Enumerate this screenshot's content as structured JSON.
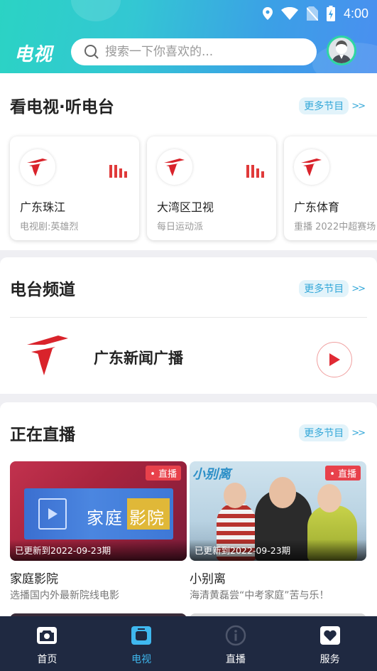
{
  "status_bar": {
    "time": "4:00"
  },
  "header": {
    "logo": "电视",
    "search_placeholder": "搜索一下你喜欢的..."
  },
  "section_tv": {
    "title": "看电视·听电台",
    "more": "更多节目",
    "arrow": ">>",
    "channels": [
      {
        "name": "广东珠江",
        "program": "电视剧:英雄烈"
      },
      {
        "name": "大湾区卫视",
        "program": "每日运动派"
      },
      {
        "name": "广东体育",
        "program": "重播 2022中超赛场"
      }
    ]
  },
  "section_radio": {
    "title": "电台频道",
    "more": "更多节目",
    "arrow": ">>",
    "station": {
      "name": "广东新闻广播"
    }
  },
  "section_live": {
    "title": "正在直播",
    "more": "更多节目",
    "arrow": ">>",
    "badge": "• 直播",
    "items": [
      {
        "title": "家庭影院",
        "desc": "选播国内外最新院线电影",
        "update": "已更新到2022-09-23期",
        "poster_text_1": "家庭",
        "poster_text_2": "影院"
      },
      {
        "title": "小别离",
        "desc": "海清黄磊尝“中考家庭”苦与乐！",
        "update": "已更新到2022-09-23期",
        "poster_logo": "小别离"
      }
    ]
  },
  "bottom_nav": {
    "items": [
      {
        "label": "首页",
        "icon": "home-camera-icon"
      },
      {
        "label": "电视",
        "icon": "tv-icon",
        "active": true
      },
      {
        "label": "直播",
        "icon": "info-icon"
      },
      {
        "label": "服务",
        "icon": "heart-icon"
      }
    ]
  },
  "colors": {
    "accent": "#3fb8ef",
    "brand_red": "#e03a3a",
    "nav_bg": "#1f2941"
  }
}
